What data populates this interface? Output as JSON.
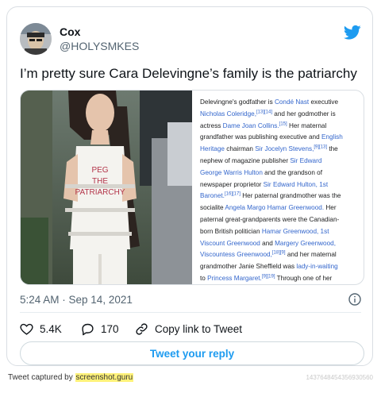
{
  "author": {
    "name": "Cox",
    "handle": "@HOLYSMKES"
  },
  "tweet": {
    "text": "I’m pretty sure Cara Delevingne’s family is the patriarchy",
    "timestamp": "5:24 AM · Sep 14, 2021"
  },
  "photo": {
    "outfit_text": [
      "PEG",
      "THE",
      "PATRIARCHY"
    ]
  },
  "wiki_text": [
    [
      {
        "t": "Delevingne's godfather is "
      },
      {
        "t": "Condé Nast",
        "l": 1
      },
      {
        "t": " executive"
      }
    ],
    [
      {
        "t": "Nicholas Coleridge,",
        "l": 1
      },
      {
        "t": "[13][14]",
        "s": 1
      },
      {
        "t": " and her godmother is"
      }
    ],
    [
      {
        "t": "actress "
      },
      {
        "t": "Dame Joan Collins.",
        "l": 1
      },
      {
        "t": "[15]",
        "s": 1
      },
      {
        "t": " Her maternal"
      }
    ],
    [
      {
        "t": "grandfather was publishing executive and "
      },
      {
        "t": "English",
        "l": 1
      }
    ],
    [
      {
        "t": "Heritage",
        "l": 1
      },
      {
        "t": " chairman "
      },
      {
        "t": "Sir Jocelyn Stevens,",
        "l": 1
      },
      {
        "t": "[9][13]",
        "s": 1
      },
      {
        "t": " the"
      }
    ],
    [
      {
        "t": "nephew of magazine publisher "
      },
      {
        "t": "Sir Edward",
        "l": 1
      }
    ],
    [
      {
        "t": "George Warris Hulton",
        "l": 1
      },
      {
        "t": " and the grandson of"
      }
    ],
    [
      {
        "t": "newspaper proprietor "
      },
      {
        "t": "Sir Edward Hulton, 1st",
        "l": 1
      }
    ],
    [
      {
        "t": "Baronet.",
        "l": 1
      },
      {
        "t": "[16][17]",
        "s": 1
      },
      {
        "t": " Her paternal grandmother was the"
      }
    ],
    [
      {
        "t": "socialite "
      },
      {
        "t": "Angela Margo Hamar Greenwood.",
        "l": 1
      },
      {
        "t": " Her"
      }
    ],
    [
      {
        "t": "paternal great-grandparents were the Canadian-"
      }
    ],
    [
      {
        "t": "born British politician "
      },
      {
        "t": "Hamar Greenwood, 1st",
        "l": 1
      }
    ],
    [
      {
        "t": "Viscount Greenwood",
        "l": 1
      },
      {
        "t": " and "
      },
      {
        "t": "Margery Greenwood,",
        "l": 1
      }
    ],
    [
      {
        "t": "Viscountess Greenwood,",
        "l": 1
      },
      {
        "t": "[18][9]",
        "s": 1
      },
      {
        "t": " and her maternal"
      }
    ],
    [
      {
        "t": "grandmother Janie Sheffield was "
      },
      {
        "t": "lady-in-waiting",
        "l": 1
      }
    ],
    [
      {
        "t": "to "
      },
      {
        "t": "Princess Margaret.",
        "l": 1
      },
      {
        "t": "[9][19]",
        "s": 1
      },
      {
        "t": " Through one of her"
      }
    ],
    [
      {
        "t": "maternal great-great-grandfathers, Sir Lionel"
      }
    ]
  ],
  "actions": {
    "likes": "5.4K",
    "replies": "170",
    "copy_link": "Copy link to Tweet",
    "reply_button": "Tweet your reply"
  },
  "footer": {
    "prefix": "Tweet captured by ",
    "site": "screenshot.guru",
    "id": "1437648454356930560"
  },
  "colors": {
    "accent": "#1d9bf0",
    "link": "#3366cc",
    "text": "#0f1419",
    "secondary": "#536471"
  },
  "icons": [
    "twitter-bird-icon",
    "info-icon",
    "heart-icon",
    "reply-icon",
    "link-icon"
  ]
}
